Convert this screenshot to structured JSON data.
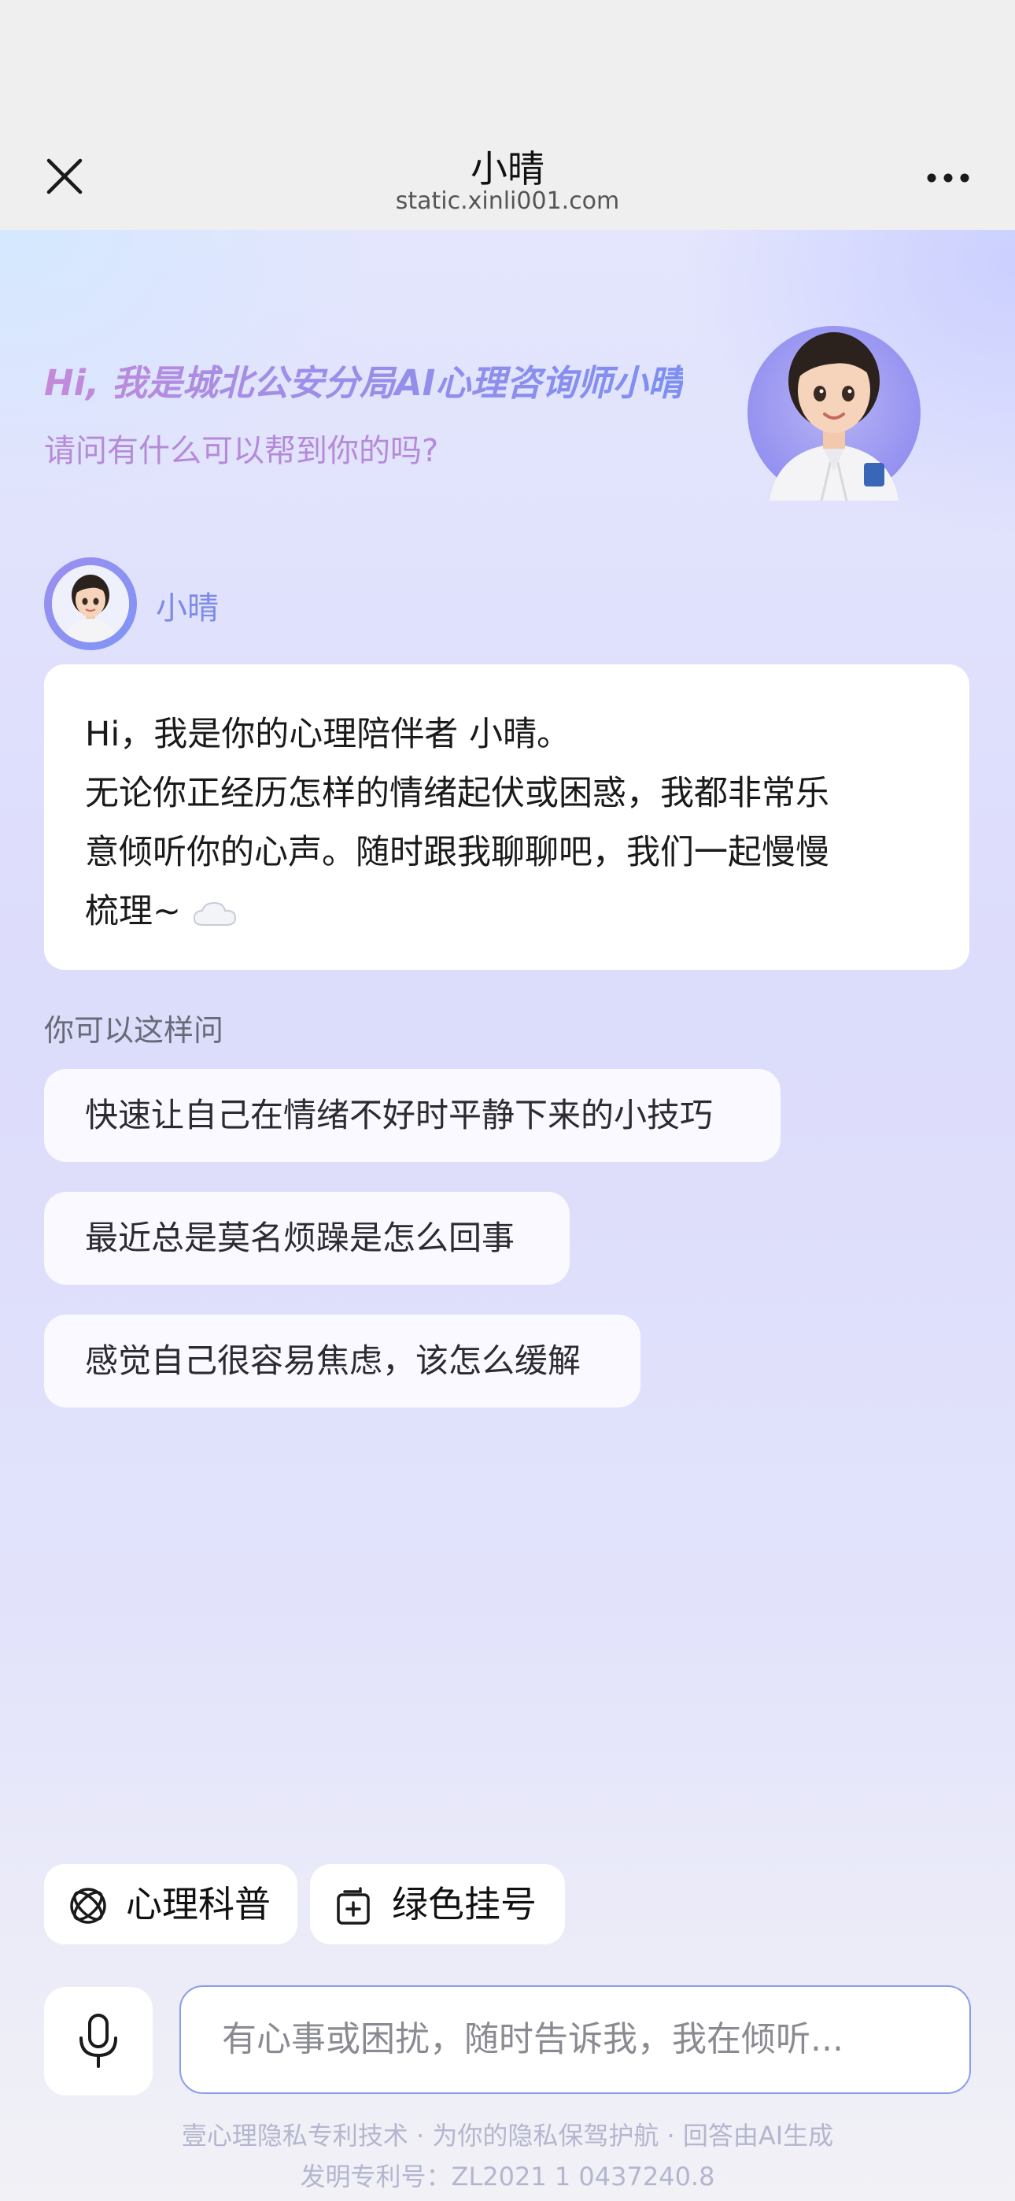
{
  "nav": {
    "title": "小晴",
    "url": "static.xinli001.com"
  },
  "hero": {
    "title": "Hi, 我是城北公安分局AI心理咨询师小晴",
    "subtitle": "请问有什么可以帮到你的吗?"
  },
  "chat": {
    "bot_name": "小晴",
    "greeting_lines": [
      "Hi，我是你的心理陪伴者 小晴。",
      "无论你正经历怎样的情绪起伏或困惑，我都非常乐",
      "意倾听你的心声。随时跟我聊聊吧，我们一起慢慢",
      "梳理~"
    ]
  },
  "suggestions": {
    "label": "你可以这样问",
    "items": [
      "快速让自己在情绪不好时平静下来的小技巧",
      "最近总是莫名烦躁是怎么回事",
      "感觉自己很容易焦虑，该怎么缓解"
    ]
  },
  "tools": [
    {
      "label": "心理科普",
      "icon": "atom-icon"
    },
    {
      "label": "绿色挂号",
      "icon": "add-register-icon"
    }
  ],
  "input": {
    "placeholder": "有心事或困扰，随时告诉我，我在倾听...",
    "value": ""
  },
  "footer": {
    "line1": "壹心理隐私专利技术 · 为你的隐私保驾护航 · 回答由AI生成",
    "line2": "发明专利号：ZL2021 1 0437240.8"
  },
  "colors": {
    "accent": "#7d8ae8",
    "input_border": "#8c9cec",
    "hero_gradient_start": "#c58ad8",
    "hero_gradient_end": "#7c8ff2"
  }
}
